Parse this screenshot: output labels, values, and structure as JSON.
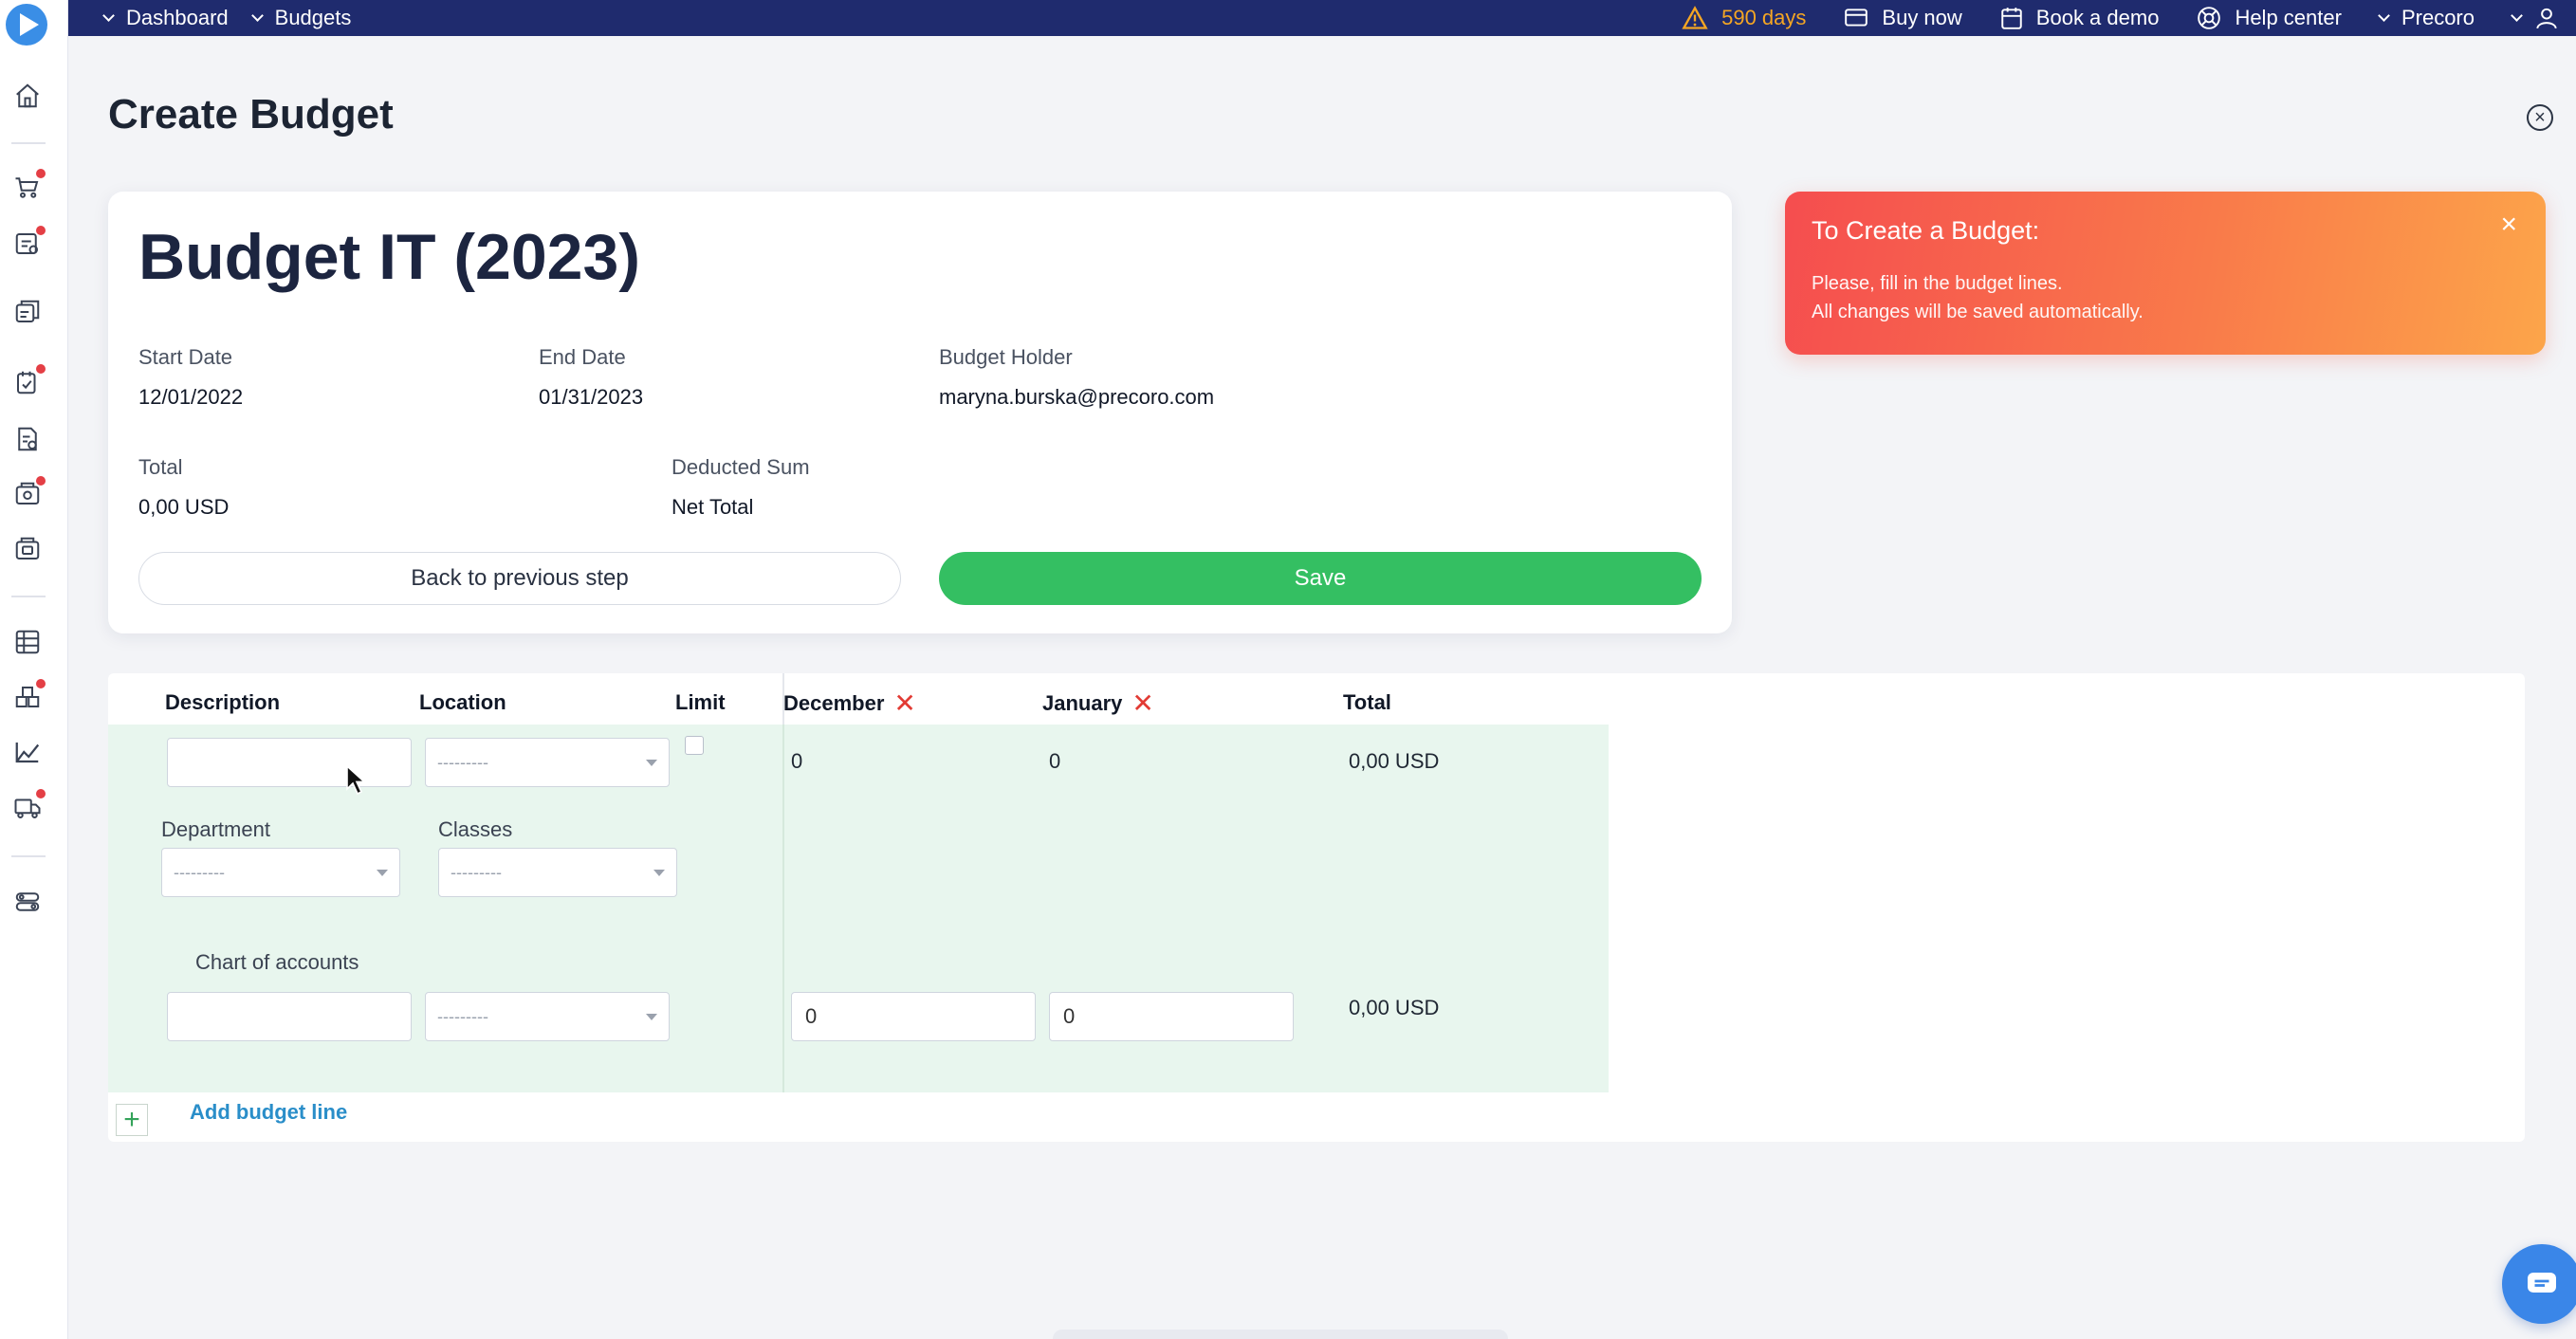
{
  "topbar": {
    "breadcrumbs": [
      "Dashboard",
      "Budgets"
    ],
    "trial_days": "590 days",
    "buy_now": "Buy now",
    "book_demo": "Book a demo",
    "help_center": "Help center",
    "company": "Precoro"
  },
  "page": {
    "title": "Create Budget",
    "close_symbol": "×"
  },
  "budget": {
    "name": "Budget IT (2023)",
    "start_date_label": "Start Date",
    "start_date": "12/01/2022",
    "end_date_label": "End Date",
    "end_date": "01/31/2023",
    "holder_label": "Budget Holder",
    "holder": "maryna.burska@precoro.com",
    "total_label": "Total",
    "total": "0,00 USD",
    "deducted_label": "Deducted Sum",
    "deducted": "Net Total",
    "back_button": "Back to previous step",
    "save_button": "Save"
  },
  "notice": {
    "title": "To Create a Budget:",
    "line1": "Please, fill in the budget lines.",
    "line2": "All changes will be saved automatically.",
    "close": "×",
    "colors": {
      "start": "#f54d4f",
      "end": "#fca54a"
    }
  },
  "table": {
    "headers": {
      "description": "Description",
      "location": "Location",
      "limit": "Limit",
      "month1": "December",
      "month2": "January",
      "total": "Total"
    },
    "remove_symbol": "✕",
    "row1": {
      "location_select": "---------",
      "december": "0",
      "january": "0",
      "total": "0,00 USD"
    },
    "department_label": "Department",
    "department_select": "---------",
    "classes_label": "Classes",
    "classes_select": "---------",
    "chart_of_accounts_label": "Chart of accounts",
    "row2": {
      "select": "---------",
      "december": "0",
      "january": "0",
      "total": "0,00 USD"
    },
    "plus_symbol": "+",
    "add_line": "Add budget line"
  },
  "colors": {
    "topbar": "#1f2b6e",
    "save": "#34bf62",
    "line_bg": "#e8f6ee",
    "link": "#2a8ec9",
    "warning": "#f5a623"
  }
}
